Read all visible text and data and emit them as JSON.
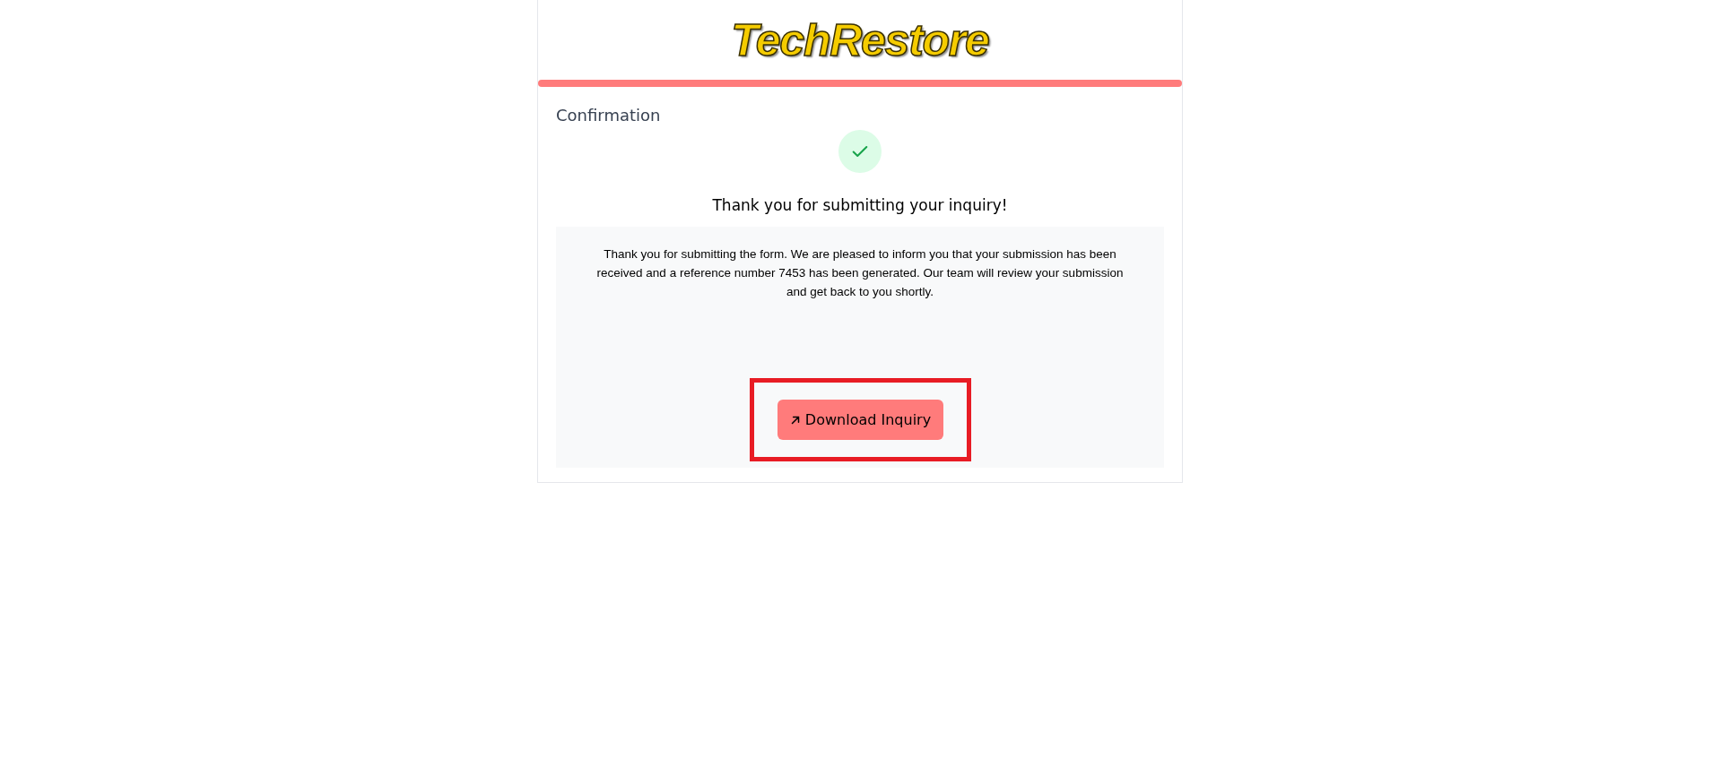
{
  "logo": {
    "text": "TechRestore"
  },
  "section_title": "Confirmation",
  "status": {
    "kind": "success"
  },
  "heading": "Thank you for submitting your inquiry!",
  "message": "Thank you for submitting the form. We are pleased to inform you that your submission has been received and a reference number 7453 has been generated. Our team will review your submission and get back to you shortly.",
  "download_button": {
    "label": "Download Inquiry",
    "highlighted": true
  }
}
